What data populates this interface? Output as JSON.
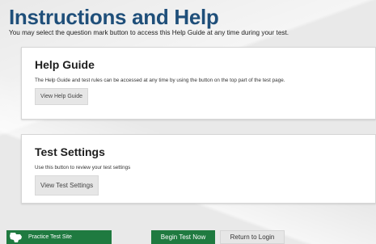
{
  "header": {
    "title": "Instructions and Help",
    "intro": "You may select the question mark button to access this Help Guide at any time during your test."
  },
  "help_guide": {
    "title": "Help Guide",
    "description": "The Help Guide and test rules can be accessed at any time by using the button on the top part of the test page.",
    "button_label": "View Help Guide"
  },
  "test_settings": {
    "title": "Test Settings",
    "description": "Use this button to review your test settings",
    "button_label": "View Test Settings"
  },
  "footer": {
    "site_label": "Practice Test Site",
    "site_icon": "state-map-icon",
    "begin_label": "Begin Test Now",
    "return_label": "Return to Login"
  },
  "colors": {
    "title": "#1f4f7a",
    "accent_green": "#1f7a40",
    "button_gray": "#e6e6e6"
  }
}
